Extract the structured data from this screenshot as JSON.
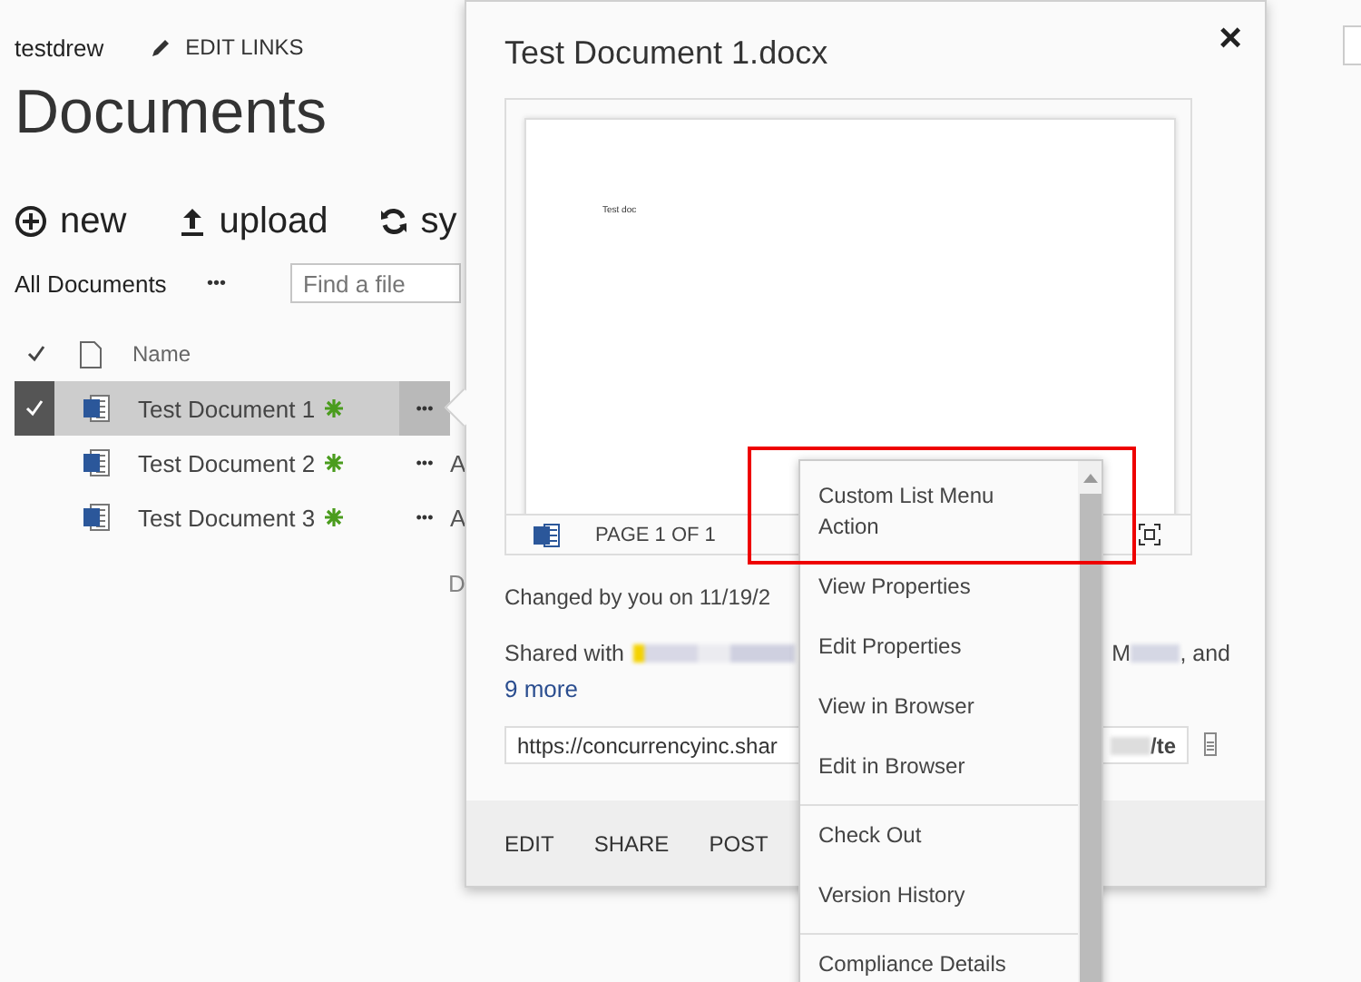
{
  "site": {
    "name": "testdrew",
    "edit_links": "EDIT LINKS"
  },
  "page_title": "Documents",
  "toolbar": [
    {
      "kind": "new",
      "label": "new"
    },
    {
      "kind": "upload",
      "label": "upload"
    },
    {
      "kind": "sync",
      "label": "sy"
    }
  ],
  "view": {
    "label": "All Documents",
    "more": "•••",
    "search": {
      "placeholder": "Find a file"
    }
  },
  "table": {
    "columns": [
      "Name"
    ],
    "rows": [
      {
        "name": "Test Document 1",
        "selected": true,
        "menu": "•••"
      },
      {
        "name": "Test Document 2",
        "selected": false,
        "menu": "•••",
        "column_2": "A"
      },
      {
        "name": "Test Document 3",
        "selected": false,
        "menu": "•••",
        "column_2": "A"
      }
    ],
    "footer_fragment": "D"
  },
  "callout": {
    "title": "Test Document 1.docx",
    "close": "×",
    "preview": {
      "text": "Test doc",
      "page": "PAGE 1 OF 1"
    },
    "changed": "Changed by you on 11/19/2",
    "shared_prefix": "Shared with",
    "shared_name_end": "M",
    "shared_suffix": ", and",
    "more": "9 more",
    "url": {
      "value": "https://concurrencyinc.shar",
      "tail": "/te"
    },
    "actions": [
      "EDIT",
      "SHARE",
      "POST"
    ]
  },
  "context_menu": {
    "groups": [
      [
        "Custom List Menu Action",
        "View Properties",
        "Edit Properties",
        "View in Browser",
        "Edit in Browser"
      ],
      [
        "Check Out",
        "Version History"
      ],
      [
        "Compliance Details"
      ]
    ]
  }
}
